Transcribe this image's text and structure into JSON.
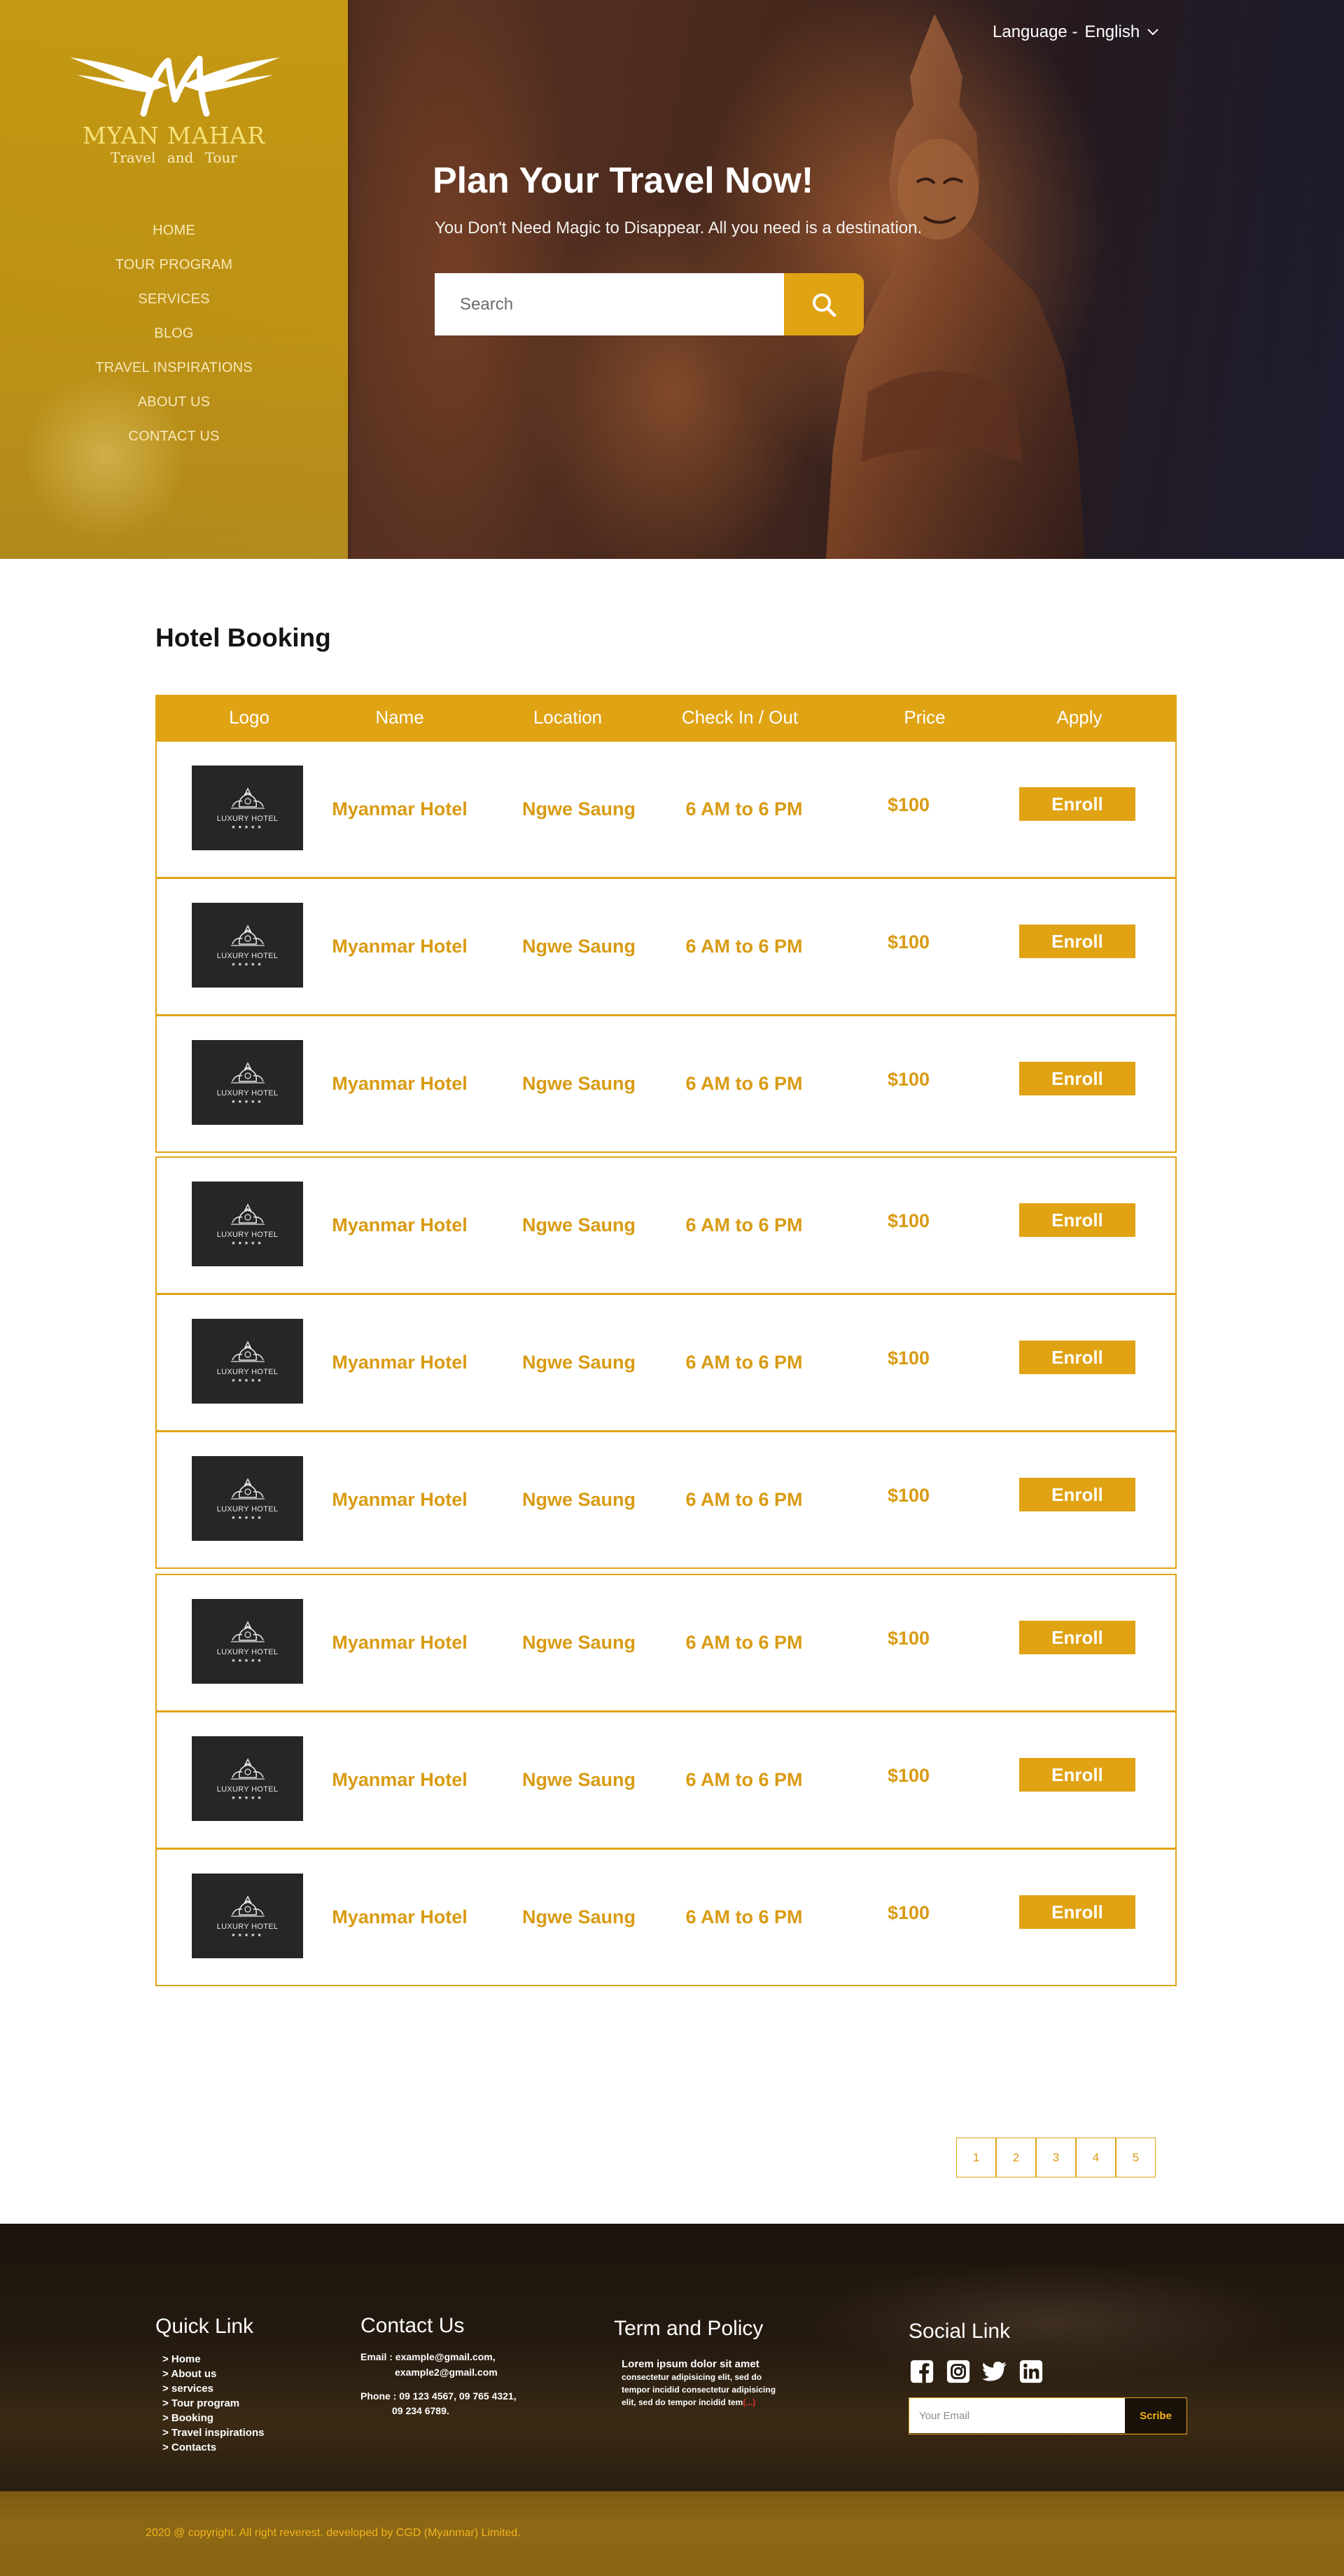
{
  "brand": {
    "name": "MYAN MAHAR",
    "tagline": "Travel and Tour"
  },
  "nav": [
    "HOME",
    "TOUR PROGRAM",
    "SERVICES",
    "BLOG",
    "TRAVEL INSPIRATIONS",
    "ABOUT US",
    "CONTACT US"
  ],
  "language": {
    "label": "Language -",
    "value": "English"
  },
  "hero": {
    "title": "Plan Your Travel Now!",
    "subtitle": "You Don't Need Magic to Disappear. All you need is a destination.",
    "search_placeholder": "Search"
  },
  "hotel_booking": {
    "title": "Hotel Booking",
    "columns": [
      "Logo",
      "Name",
      "Location",
      "Check In / Out",
      "Price",
      "Apply"
    ],
    "logo_text": "LUXURY HOTEL",
    "logo_stars": "★★★★★",
    "rows": [
      {
        "name": "Myanmar Hotel",
        "location": "Ngwe Saung",
        "time": "6 AM to 6 PM",
        "price": "$100",
        "action": "Enroll"
      },
      {
        "name": "Myanmar Hotel",
        "location": "Ngwe Saung",
        "time": "6 AM to 6 PM",
        "price": "$100",
        "action": "Enroll"
      },
      {
        "name": "Myanmar Hotel",
        "location": "Ngwe Saung",
        "time": "6 AM to 6 PM",
        "price": "$100",
        "action": "Enroll"
      },
      {
        "name": "Myanmar Hotel",
        "location": "Ngwe Saung",
        "time": "6 AM to 6 PM",
        "price": "$100",
        "action": "Enroll"
      },
      {
        "name": "Myanmar Hotel",
        "location": "Ngwe Saung",
        "time": "6 AM to 6 PM",
        "price": "$100",
        "action": "Enroll"
      },
      {
        "name": "Myanmar Hotel",
        "location": "Ngwe Saung",
        "time": "6 AM to 6 PM",
        "price": "$100",
        "action": "Enroll"
      },
      {
        "name": "Myanmar Hotel",
        "location": "Ngwe Saung",
        "time": "6 AM to 6 PM",
        "price": "$100",
        "action": "Enroll"
      },
      {
        "name": "Myanmar Hotel",
        "location": "Ngwe Saung",
        "time": "6 AM to 6 PM",
        "price": "$100",
        "action": "Enroll"
      },
      {
        "name": "Myanmar Hotel",
        "location": "Ngwe Saung",
        "time": "6 AM to 6 PM",
        "price": "$100",
        "action": "Enroll"
      }
    ]
  },
  "pagination": [
    "1",
    "2",
    "3",
    "4",
    "5"
  ],
  "footer": {
    "quick_link": {
      "title": "Quick Link",
      "items": [
        "> Home",
        "> About us",
        "> services",
        "> Tour program",
        "> Booking",
        "> Travel inspirations",
        "> Contacts"
      ]
    },
    "contact": {
      "title": "Contact Us",
      "email_line1": "Email : example@gmail.com,",
      "email_line2": "example2@gmail.com",
      "phone_line1": "Phone : 09 123 4567, 09 765 4321,",
      "phone_line2": "09 234 6789."
    },
    "term": {
      "title": "Term and Policy",
      "line1": "Lorem ipsum dolor sit amet",
      "line2": "consectetur adipisicing elit, sed do",
      "line3": "tempor incidid consectetur adipisicing",
      "line4": "elit, sed do tempor incidid tem",
      "more": "(...)"
    },
    "social": {
      "title": "Social Link",
      "icons": [
        "facebook-icon",
        "instagram-icon",
        "twitter-icon",
        "linkedin-icon"
      ],
      "email_placeholder": "Your Email",
      "button": "Scribe"
    },
    "copyright": "2020 @ copyright. All right reverest. developed by CGD (Myanmar) Limited."
  },
  "colors": {
    "accent": "#e0a313",
    "accent_text": "#d99b13",
    "footer_bg": "#241a10",
    "copy_bar": "#8a6613"
  }
}
